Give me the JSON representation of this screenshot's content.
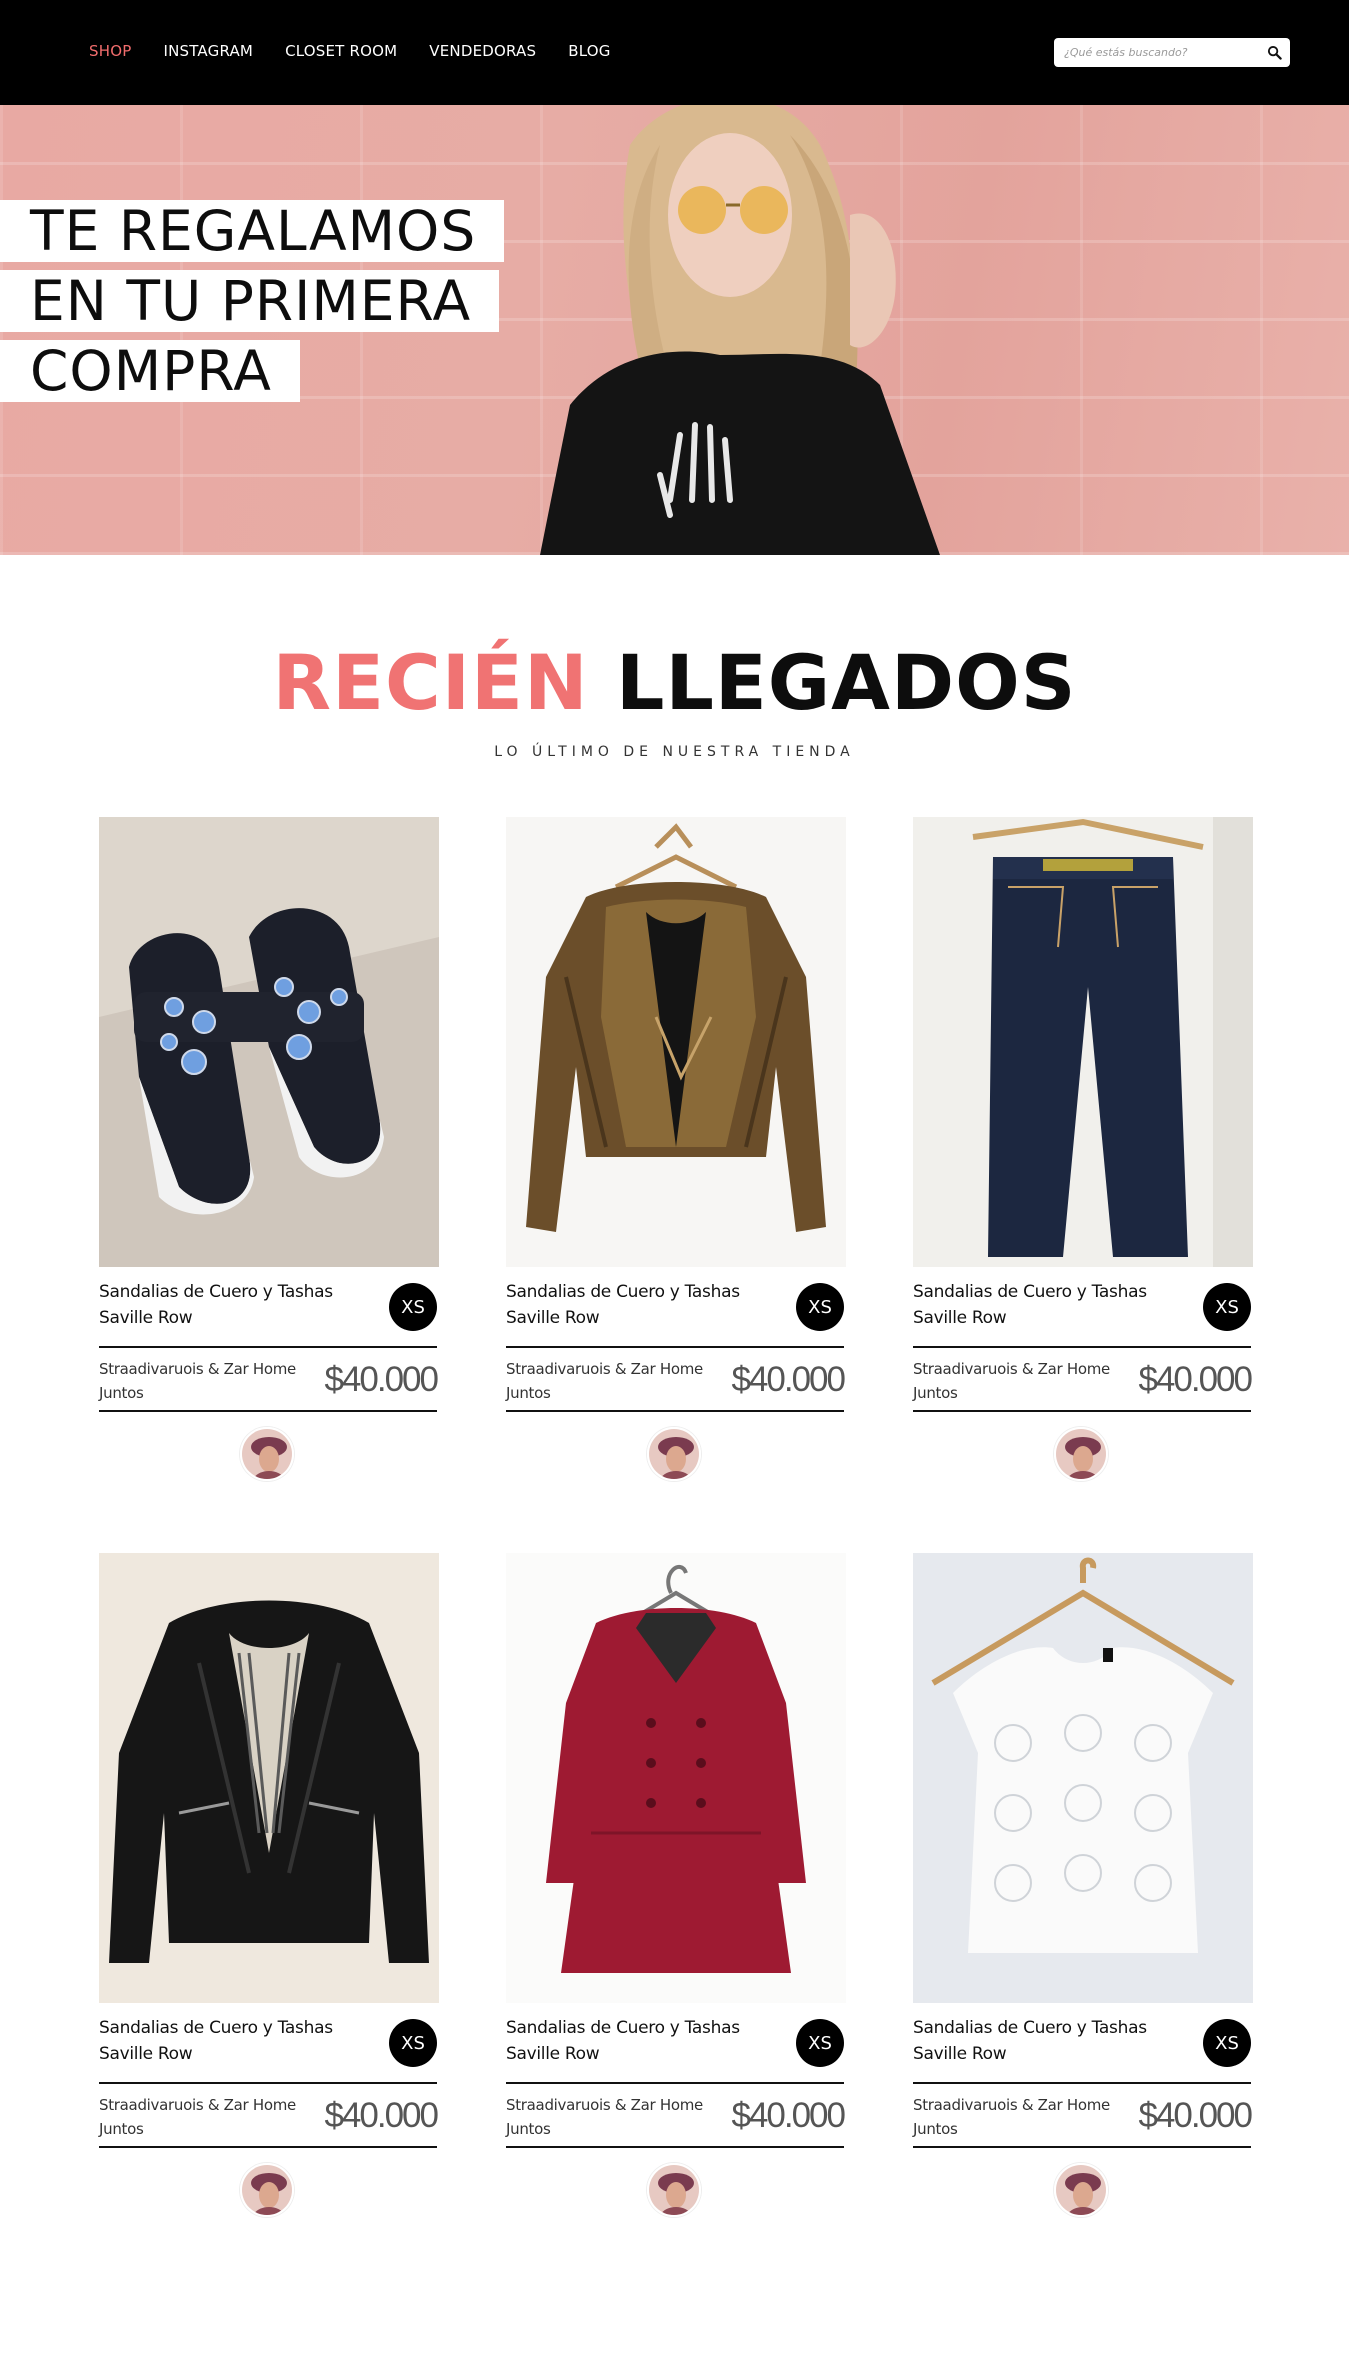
{
  "nav": {
    "items": [
      {
        "label": "SHOP",
        "active": true
      },
      {
        "label": "INSTAGRAM",
        "active": false
      },
      {
        "label": "CLOSET ROOM",
        "active": false
      },
      {
        "label": "VENDEDORAS",
        "active": false
      },
      {
        "label": "BLOG",
        "active": false
      }
    ]
  },
  "search": {
    "placeholder": "¿Qué estás buscando?",
    "icon": "search-icon"
  },
  "hero": {
    "lines": [
      "TE REGALAMOS",
      "EN TU PRIMERA",
      "COMPRA"
    ]
  },
  "section": {
    "title_accent": "RECIÉN",
    "title_main": "LLEGADOS",
    "subtitle": "LO ÚLTIMO DE NUESTRA TIENDA"
  },
  "colors": {
    "accent": "#f26d6d",
    "header_bg": "#000000",
    "hero_bg": "#e7aca5"
  },
  "products": [
    {
      "image": "black-slip-on-sneakers",
      "title": "Sandalias de Cuero y Tashas Saville Row",
      "size": "XS",
      "seller": "Straadivaruois & Zar Home Juntos",
      "price": "$40.000"
    },
    {
      "image": "bronze-leather-jacket",
      "title": "Sandalias de Cuero y Tashas Saville Row",
      "size": "XS",
      "seller": "Straadivaruois & Zar Home Juntos",
      "price": "$40.000"
    },
    {
      "image": "dark-denim-jeans",
      "title": "Sandalias de Cuero y Tashas Saville Row",
      "size": "XS",
      "seller": "Straadivaruois & Zar Home Juntos",
      "price": "$40.000"
    },
    {
      "image": "black-leather-jacket",
      "title": "Sandalias de Cuero y Tashas Saville Row",
      "size": "XS",
      "seller": "Straadivaruois & Zar Home Juntos",
      "price": "$40.000"
    },
    {
      "image": "red-wool-coat",
      "title": "Sandalias de Cuero y Tashas Saville Row",
      "size": "XS",
      "seller": "Straadivaruois & Zar Home Juntos",
      "price": "$40.000"
    },
    {
      "image": "white-lace-top",
      "title": "Sandalias de Cuero y Tashas Saville Row",
      "size": "XS",
      "seller": "Straadivaruois & Zar Home Juntos",
      "price": "$40.000"
    }
  ]
}
